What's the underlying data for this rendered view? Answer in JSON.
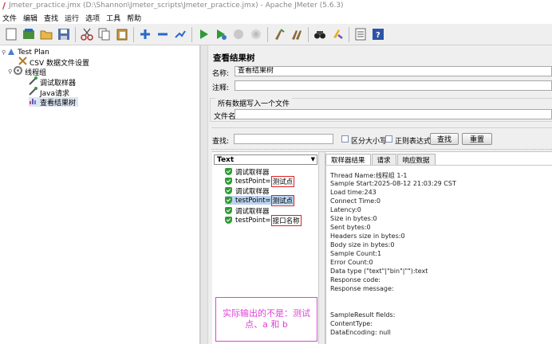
{
  "window": {
    "title": "Jmeter_practice.jmx (D:\\Shannon\\Jmeter_scripts\\Jmeter_practice.jmx) - Apache JMeter (5.6.3)"
  },
  "menu": [
    "文件",
    "编辑",
    "查找",
    "运行",
    "选项",
    "工具",
    "帮助"
  ],
  "tree": {
    "nodes": [
      {
        "label": "Test Plan",
        "icon": "test-plan-icon"
      },
      {
        "label": "CSV 数据文件设置",
        "icon": "csv-config-icon"
      },
      {
        "label": "线程组",
        "icon": "thread-group-icon"
      },
      {
        "label": "调试取样器",
        "icon": "sampler-icon"
      },
      {
        "label": "Java请求",
        "icon": "sampler-icon"
      },
      {
        "label": "查看结果树",
        "icon": "listener-icon"
      }
    ]
  },
  "panel": {
    "title": "查看结果树",
    "name_label": "名称:",
    "name_value": "查看结果树",
    "comment_label": "注释:",
    "comment_value": "",
    "write_all_label": "所有数据写入一个文件",
    "filename_label": "文件名",
    "filename_value": "",
    "search_label": "查找:",
    "search_value": "",
    "case_sensitive_label": "区分大小写",
    "regex_label": "正则表达式",
    "find_button": "查找",
    "reset_button": "重置"
  },
  "results": {
    "renderer": "Text",
    "items": [
      {
        "label": "调试取样器",
        "prefix": "",
        "highlight": ""
      },
      {
        "label": "testPoint=",
        "prefix": "testPoint=",
        "highlight": "测试点"
      },
      {
        "label": "调试取样器",
        "prefix": "",
        "highlight": ""
      },
      {
        "label": "testPoint=",
        "prefix": "testPoint=",
        "highlight": "测试点"
      },
      {
        "label": "调试取样器",
        "prefix": "",
        "highlight": ""
      },
      {
        "label": "testPoint=",
        "prefix": "testPoint=",
        "highlight": "接口名称"
      }
    ],
    "annotation": "实际输出的不是：测试点、a 和 b"
  },
  "detail": {
    "tabs": [
      "取样器结果",
      "请求",
      "响应数据"
    ],
    "lines": [
      "Thread Name:线程组 1-1",
      "Sample Start:2025-08-12 21:03:29 CST",
      "Load time:243",
      "Connect Time:0",
      "Latency:0",
      "Size in bytes:0",
      "Sent bytes:0",
      "Headers size in bytes:0",
      "Body size in bytes:0",
      "Sample Count:1",
      "Error Count:0",
      "Data type (\"text\"|\"bin\"|\"\"):text",
      "Response code:",
      "Response message:",
      "",
      "",
      "SampleResult fields:",
      "ContentType:",
      "DataEncoding: null"
    ]
  },
  "colors": {
    "highlight_border": "#e02020",
    "annotation": "#e040d8",
    "selected_row": "#bcd3ee"
  }
}
